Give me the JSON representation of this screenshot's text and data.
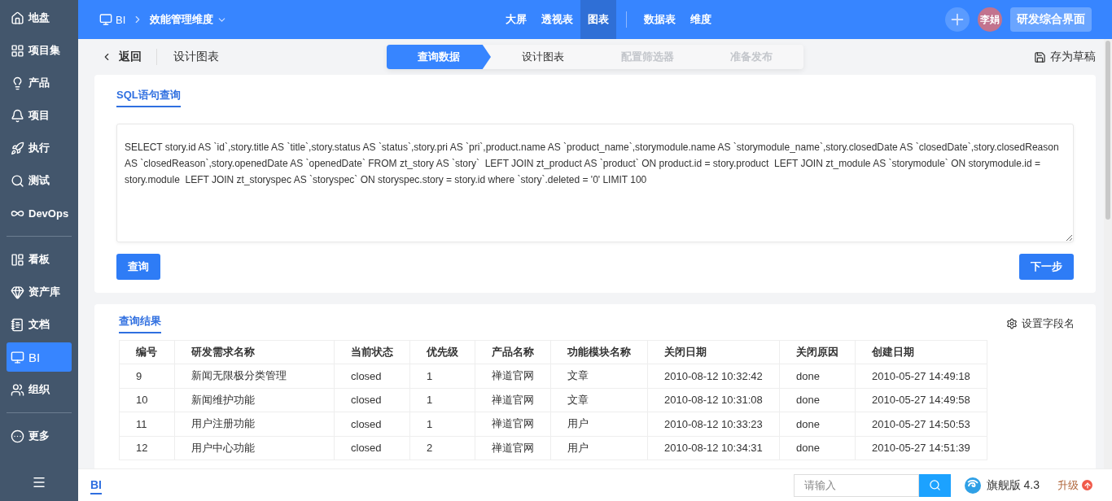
{
  "sidebar": {
    "items": [
      {
        "label": "地盘",
        "selected": false
      },
      {
        "label": "项目集",
        "selected": false
      },
      {
        "label": "产品",
        "selected": false
      },
      {
        "label": "项目",
        "selected": false
      },
      {
        "label": "执行",
        "selected": false
      },
      {
        "label": "测试",
        "selected": false
      },
      {
        "label": "DevOps",
        "selected": false
      },
      {
        "label": "看板",
        "selected": false
      },
      {
        "label": "资产库",
        "selected": false
      },
      {
        "label": "文档",
        "selected": false
      },
      {
        "label": "BI",
        "selected": true
      },
      {
        "label": "组织",
        "selected": false
      },
      {
        "label": "更多",
        "selected": false
      }
    ]
  },
  "topbar": {
    "module": "BI",
    "dimension": "效能管理维度",
    "nav": [
      {
        "label": "大屏",
        "selected": false
      },
      {
        "label": "透视表",
        "selected": false
      },
      {
        "label": "图表",
        "selected": true
      },
      {
        "label": "数据表",
        "selected": false
      },
      {
        "label": "维度",
        "selected": false
      }
    ],
    "avatar": "李娟",
    "workspace_button": "研发综合界面"
  },
  "subbar": {
    "back": "返回",
    "title": "设计图表",
    "steps": [
      {
        "label": "查询数据",
        "selected": true,
        "disabled": false
      },
      {
        "label": "设计图表",
        "selected": false,
        "disabled": false
      },
      {
        "label": "配置筛选器",
        "selected": false,
        "disabled": true
      },
      {
        "label": "准备发布",
        "selected": false,
        "disabled": true
      }
    ],
    "save_draft": "存为草稿"
  },
  "query_card": {
    "tab": "SQL语句查询",
    "sql": "SELECT story.id AS `id`,story.title AS `title`,story.status AS `status`,story.pri AS `pri`,product.name AS `product_name`,storymodule.name AS `storymodule_name`,story.closedDate AS `closedDate`,story.closedReason AS `closedReason`,story.openedDate AS `openedDate` FROM zt_story AS `story`  LEFT JOIN zt_product AS `product` ON product.id = story.product  LEFT JOIN zt_module AS `storymodule` ON storymodule.id = story.module  LEFT JOIN zt_storyspec AS `storyspec` ON storyspec.story = story.id where `story`.deleted = '0' LIMIT 100",
    "query_button": "查询",
    "next_button": "下一步"
  },
  "result_card": {
    "tab": "查询结果",
    "field_names_button": "设置字段名",
    "table": {
      "columns": [
        "编号",
        "研发需求名称",
        "当前状态",
        "优先级",
        "产品名称",
        "功能模块名称",
        "关闭日期",
        "关闭原因",
        "创建日期"
      ],
      "rows": [
        [
          "9",
          "新闻无限极分类管理",
          "closed",
          "1",
          "禅道官网",
          "文章",
          "2010-08-12 10:32:42",
          "done",
          "2010-05-27 14:49:18"
        ],
        [
          "10",
          "新闻维护功能",
          "closed",
          "1",
          "禅道官网",
          "文章",
          "2010-08-12 10:31:08",
          "done",
          "2010-05-27 14:49:58"
        ],
        [
          "11",
          "用户注册功能",
          "closed",
          "1",
          "禅道官网",
          "用户",
          "2010-08-12 10:33:23",
          "done",
          "2010-05-27 14:50:53"
        ],
        [
          "12",
          "用户中心功能",
          "closed",
          "2",
          "禅道官网",
          "用户",
          "2010-08-12 10:34:31",
          "done",
          "2010-05-27 14:51:39"
        ]
      ]
    }
  },
  "footer": {
    "tab": "BI",
    "search": {
      "placeholder": "请输入"
    },
    "edition": "旗舰版 4.3",
    "upgrade": "升级"
  }
}
